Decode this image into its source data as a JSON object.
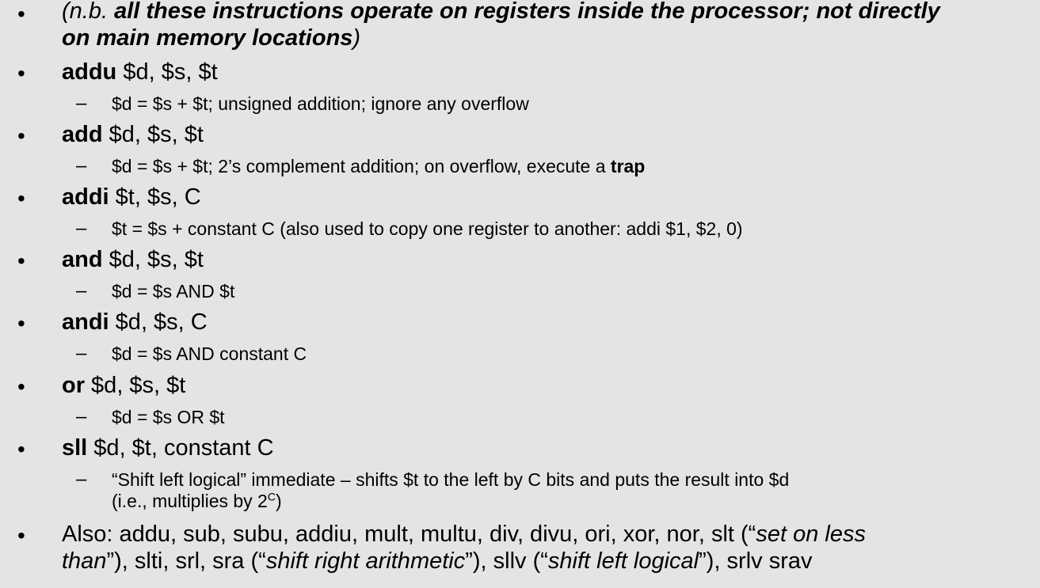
{
  "note": {
    "open": "(n.b. ",
    "bold_part_1": "all these instructions operate on registers inside the processor; not directly",
    "bold_part_2": "on main memory locations",
    "close": ")"
  },
  "items": [
    {
      "op": "addu",
      "args": " $d, $s, $t",
      "desc_before": "$d = $s + $t; unsigned addition; ignore any overflow",
      "desc_bold": "",
      "desc_after": ""
    },
    {
      "op": "add",
      "args": " $d, $s, $t",
      "desc_before": "$d = $s + $t; 2’s complement addition; on overflow, execute a ",
      "desc_bold": "trap",
      "desc_after": ""
    },
    {
      "op": "addi",
      "args": " $t, $s, C",
      "desc_before": "$t = $s + constant C (also used to copy one register to another: addi $1, $2, 0)",
      "desc_bold": "",
      "desc_after": ""
    },
    {
      "op": "and",
      "args": " $d, $s, $t",
      "desc_before": "$d = $s AND $t",
      "desc_bold": "",
      "desc_after": ""
    },
    {
      "op": "andi",
      "args": " $d, $s, C",
      "desc_before": "$d = $s AND constant C",
      "desc_bold": "",
      "desc_after": ""
    },
    {
      "op": "or",
      "args": " $d, $s, $t",
      "desc_before": "$d = $s OR $t",
      "desc_bold": "",
      "desc_after": ""
    }
  ],
  "sll": {
    "op": "sll",
    "args": " $d, $t, constant C",
    "desc_line1": "“Shift left logical” immediate – shifts $t to the left by C bits and puts the result into $d",
    "desc_line2_prefix": "(i.e., multiplies by 2",
    "desc_line2_sup": "C",
    "desc_line2_suffix": ")"
  },
  "also": {
    "line1_a": "Also: addu, sub, subu, addiu, mult, multu, div, divu, ori, xor, nor, slt (“",
    "line1_italic": "set on less",
    "line2_italic_a": "than",
    "line2_b": "”), slti, srl, sra (“",
    "line2_italic_b": "shift right arithmetic",
    "line2_c": "”), sllv (“",
    "line2_italic_c": "shift left logical",
    "line2_d": "”), srlv srav"
  },
  "bullet_char": "•",
  "dash_char": "–"
}
